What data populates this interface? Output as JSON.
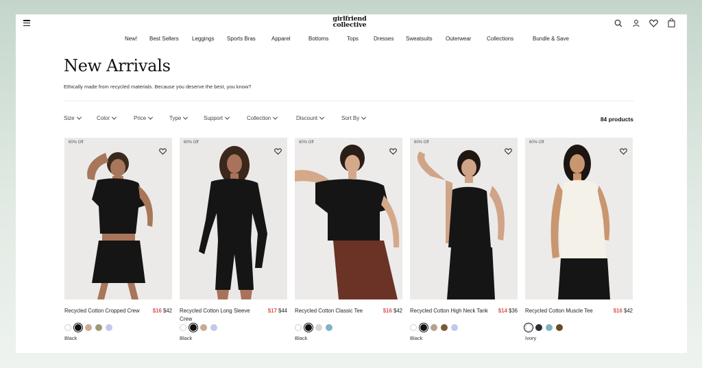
{
  "header": {
    "logo_line1": "girlfriend",
    "logo_line2": "collective"
  },
  "nav": [
    "New!",
    "Best Sellers",
    "Leggings",
    "Sports Bras",
    "Apparel",
    "Bottoms",
    "Tops",
    "Dresses",
    "Sweatsuits",
    "Outerwear",
    "Collections",
    "Bundle & Save"
  ],
  "page": {
    "title": "New Arrivals",
    "subtitle": "Ethically made from recycled materials. Because you deserve the best, you know?"
  },
  "filters": [
    "Size",
    "Color",
    "Price",
    "Type",
    "Support",
    "Collection",
    "Discount",
    "Sort By"
  ],
  "product_count": "84 products",
  "products": [
    {
      "badge": "60% Off",
      "name": "Recycled Cotton Cropped Crew",
      "sale_price": "$16",
      "regular_price": "$42",
      "color_name": "Black",
      "swatches": [
        "#ffffff",
        "#111111",
        "#c9ab92",
        "#9b9a78",
        "#c3c9ea"
      ],
      "selected": 1
    },
    {
      "badge": "60% Off",
      "name": "Recycled Cotton Long Sleeve Crew",
      "sale_price": "$17",
      "regular_price": "$44",
      "color_name": "Black",
      "swatches": [
        "#ffffff",
        "#111111",
        "#c9ab92",
        "#c3c9ea"
      ],
      "selected": 1
    },
    {
      "badge": "60% Off",
      "name": "Recycled Cotton Classic Tee",
      "sale_price": "$16",
      "regular_price": "$42",
      "color_name": "Black",
      "swatches": [
        "#ffffff",
        "#111111",
        "#d6d6d6",
        "#7fb3c2"
      ],
      "selected": 1
    },
    {
      "badge": "60% Off",
      "name": "Recycled Cotton High Neck Tank",
      "sale_price": "$14",
      "regular_price": "$36",
      "color_name": "Black",
      "swatches": [
        "#ffffff",
        "#111111",
        "#b9a08e",
        "#7a5a34",
        "#c3c9ea"
      ],
      "selected": 1
    },
    {
      "badge": "60% Off",
      "name": "Recycled Cotton Muscle Tee",
      "sale_price": "$16",
      "regular_price": "$42",
      "color_name": "Ivory",
      "swatches": [
        "#ffffff",
        "#2c2c36",
        "#7fb3c2",
        "#6b4a24"
      ],
      "selected": 0
    }
  ]
}
